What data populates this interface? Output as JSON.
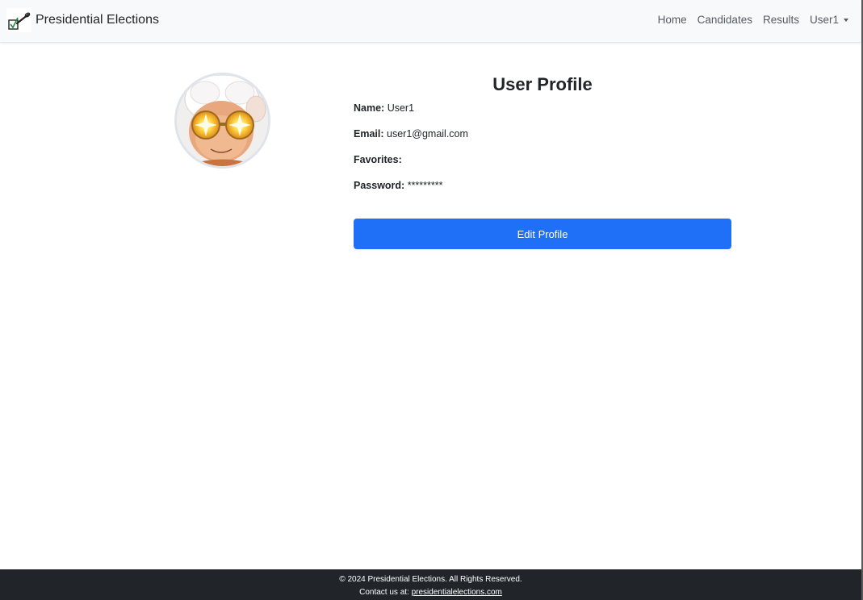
{
  "navbar": {
    "brand_title": "Presidential Elections",
    "links": {
      "home": "Home",
      "candidates": "Candidates",
      "results": "Results",
      "user": "User1"
    }
  },
  "profile": {
    "title": "User Profile",
    "fields": {
      "name_label": "Name:",
      "name_value": "User1",
      "email_label": "Email:",
      "email_value": "user1@gmail.com",
      "favorites_label": "Favorites:",
      "favorites_value": "",
      "password_label": "Password:",
      "password_value": "*********"
    },
    "edit_button": "Edit Profile"
  },
  "footer": {
    "copyright": "© 2024 Presidential Elections. All Rights Reserved.",
    "contact_prefix": "Contact us at:",
    "contact_link": "presidentialelections.com"
  },
  "colors": {
    "primary": "#1f6ff7",
    "navbar_bg": "#f8f9fa",
    "footer_bg": "#212529"
  }
}
